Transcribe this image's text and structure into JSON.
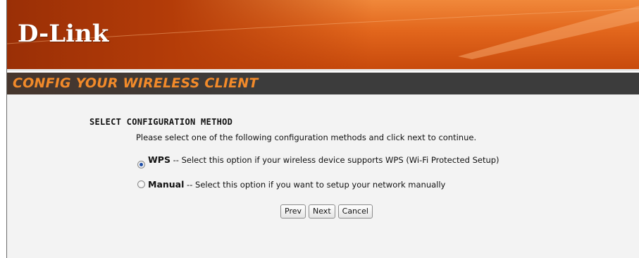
{
  "header": {
    "logo_text": "D-Link",
    "colors": {
      "banner_orange": "#e2661c",
      "title_orange": "#f28a2a",
      "title_bar": "#3c3c3c"
    }
  },
  "page": {
    "title": "CONFIG YOUR WIRELESS CLIENT"
  },
  "content": {
    "section_title": "SELECT CONFIGURATION METHOD",
    "instruction": "Please select one of the following configuration methods and click next to continue.",
    "options": [
      {
        "label": "WPS",
        "description": " -- Select this option if your wireless device supports WPS (Wi-Fi Protected Setup)",
        "selected": true
      },
      {
        "label": "Manual",
        "description": " -- Select this option if you want to setup your network manually",
        "selected": false
      }
    ]
  },
  "buttons": {
    "prev_label": "Prev",
    "next_label": "Next",
    "cancel_label": "Cancel"
  }
}
